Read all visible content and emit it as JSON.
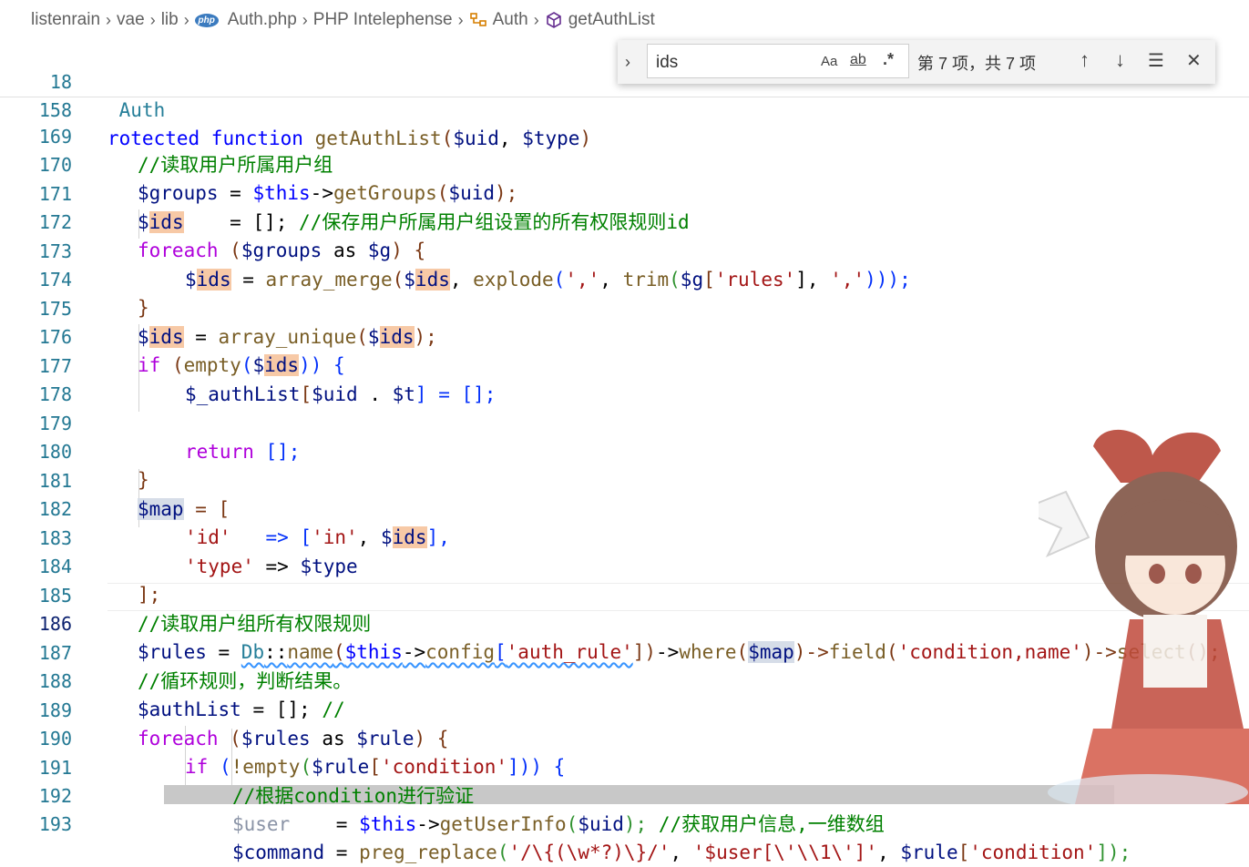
{
  "breadcrumb": {
    "items": [
      "listenrain",
      "vae",
      "lib",
      "Auth.php",
      "PHP Intelephense",
      "Auth",
      "getAuthList"
    ],
    "php_badge": "php"
  },
  "sticky": [
    {
      "num": "18",
      "text": " Auth"
    },
    {
      "num": "158",
      "prefix": "rotected ",
      "kw": "function",
      "fn": "getAuthList",
      "rest1": "(",
      "v1": "$uid",
      "rest2": ", ",
      "v2": "$type",
      "rest3": ")"
    }
  ],
  "find": {
    "toggle_icon": "›",
    "value": "ids",
    "match_case": "Aa",
    "whole_word": "ab",
    "regex": ".*",
    "count": "第 7 项，共 7 项",
    "prev": "↑",
    "next": "↓",
    "in_selection": "☰",
    "close": "✕"
  },
  "lines": {
    "169": {
      "num": "169",
      "c": "//读取用户所属用户组"
    },
    "170": {
      "num": "170",
      "a": "$groups",
      "b": " = ",
      "c": "$this",
      "d": "->",
      "e": "getGroups",
      "f": "(",
      "g": "$uid",
      "h": ");"
    },
    "171": {
      "num": "171",
      "a": "$",
      "b": "ids",
      "c": "    = [];",
      "d": " //保存用户所属用户组设置的所有权限规则id"
    },
    "172": {
      "num": "172",
      "a": "foreach",
      "b": " (",
      "c": "$groups",
      "d": " as ",
      "e": "$g",
      "f": ") {"
    },
    "173": {
      "num": "173",
      "a": "$",
      "b": "ids",
      "c": " = ",
      "d": "array_merge",
      "e": "(",
      "f": "$",
      "g": "ids",
      "h": ", ",
      "i": "explode",
      "j": "(",
      "k": "','",
      "l": ", ",
      "m": "trim",
      "n": "(",
      "o": "$g",
      "p": "[",
      "q": "'rules'",
      "r": "], ",
      "s": "','",
      "t": ")));"
    },
    "174": {
      "num": "174",
      "a": "}"
    },
    "175": {
      "num": "175",
      "a": "$",
      "b": "ids",
      "c": " = ",
      "d": "array_unique",
      "e": "(",
      "f": "$",
      "g": "ids",
      "h": ");"
    },
    "176": {
      "num": "176",
      "a": "if",
      "b": " (",
      "c": "empty",
      "d": "(",
      "e": "$",
      "f": "ids",
      "g": ")) {"
    },
    "177": {
      "num": "177",
      "a": "$_authList",
      "b": "[",
      "c": "$uid",
      "d": " . ",
      "e": "$t",
      "f": "] = [];"
    },
    "178": {
      "num": "178"
    },
    "179": {
      "num": "179",
      "a": "return",
      "b": " [];"
    },
    "180": {
      "num": "180",
      "a": "}"
    },
    "181": {
      "num": "181",
      "a": "$map",
      "b": " = ["
    },
    "182": {
      "num": "182",
      "a": "'id'",
      "b": "   => [",
      "c": "'in'",
      "d": ", ",
      "e": "$",
      "f": "ids",
      "g": "],"
    },
    "183": {
      "num": "183",
      "a": "'type'",
      "b": " => ",
      "c": "$type"
    },
    "184": {
      "num": "184",
      "a": "];"
    },
    "185": {
      "num": "185",
      "c": "//读取用户组所有权限规则"
    },
    "186": {
      "num": "186",
      "a": "$rules",
      "b": " = ",
      "c": "Db",
      "d": "::",
      "e": "name",
      "f": "(",
      "g": "$this",
      "h": "->",
      "i": "config",
      "j": "[",
      "k": "'auth_rule'",
      "l": "])",
      "m": "->",
      "n": "where",
      "o": "(",
      "p": "$map",
      "q": ")->",
      "r": "field",
      "s": "(",
      "t": "'condition,name'",
      "u": ")->",
      "v": "select",
      "w": "();"
    },
    "187": {
      "num": "187",
      "c": "//循环规则，判断结果。"
    },
    "188": {
      "num": "188",
      "a": "$authList",
      "b": " = []; ",
      "c": "//"
    },
    "189": {
      "num": "189",
      "a": "foreach",
      "b": " (",
      "c": "$rules",
      "d": " as ",
      "e": "$rule",
      "f": ") {"
    },
    "190": {
      "num": "190",
      "a": "if",
      "b": " (",
      "c": "!empty",
      "d": "(",
      "e": "$rule",
      "f": "[",
      "g": "'condition'",
      "h": "])) {"
    },
    "191": {
      "num": "191",
      "c": "//根据condition进行验证"
    },
    "192": {
      "num": "192",
      "a": "$user",
      "b": "    = ",
      "c": "$this",
      "d": "->",
      "e": "getUserInfo",
      "f": "(",
      "g": "$uid",
      "h": "); ",
      "i": "//获取用户信息,一维数组"
    },
    "193": {
      "num": "193",
      "a": "$command",
      "b": " = ",
      "c": "preg_replace",
      "d": "(",
      "e": "'/\\{(\\w*?)\\}/'",
      "f": ", ",
      "g": "'$user[\\'\\\\1\\']'",
      "h": ", ",
      "i": "$rule",
      "j": "[",
      "k": "'condition'",
      "l": "]);"
    }
  },
  "colors": {
    "comment": "#008000",
    "keyword": "#0000ff",
    "control": "#af00db",
    "variable": "#001080",
    "function": "#795e26",
    "string": "#a31515",
    "highlight": "#f7c9a6"
  }
}
